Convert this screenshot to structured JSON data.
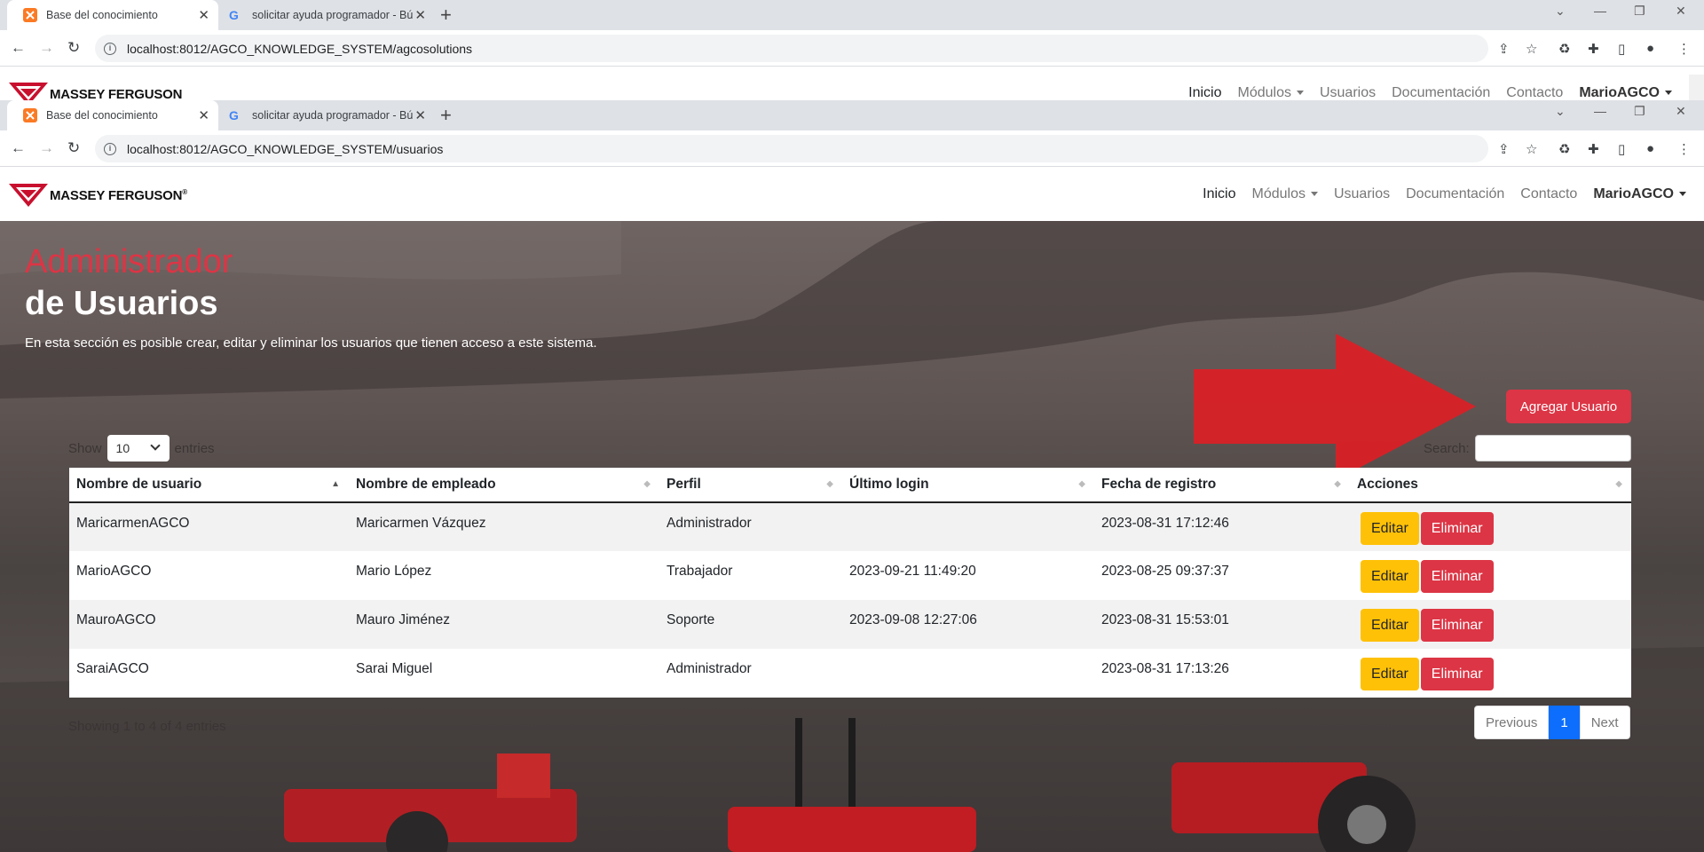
{
  "browser": {
    "tabs": [
      {
        "title": "Base del conocimiento"
      },
      {
        "title": "solicitar ayuda programador - Bú"
      }
    ],
    "url_top": "localhost:8012/AGCO_KNOWLEDGE_SYSTEM/agcosolutions",
    "url": "localhost:8012/AGCO_KNOWLEDGE_SYSTEM/usuarios"
  },
  "nav": {
    "brand": "MASSEY FERGUSON",
    "registered": "®",
    "items": [
      "Inicio",
      "Módulos",
      "Usuarios",
      "Documentación",
      "Contacto"
    ],
    "user": "MarioAGCO"
  },
  "page": {
    "title_line1": "Administrador",
    "title_line2": "de Usuarios",
    "description": "En esta sección es posible crear, editar y eliminar los usuarios que tienen acceso a este sistema.",
    "add_button": "Agregar Usuario"
  },
  "table": {
    "show_label": "Show",
    "entries_label": "entries",
    "page_length": "10",
    "search_label": "Search:",
    "columns": [
      "Nombre de usuario",
      "Nombre de empleado",
      "Perfil",
      "Último login",
      "Fecha de registro",
      "Acciones"
    ],
    "rows": [
      [
        "MaricarmenAGCO",
        "Maricarmen Vázquez",
        "Administrador",
        "",
        "2023-08-31 17:12:46"
      ],
      [
        "MarioAGCO",
        "Mario López",
        "Trabajador",
        "2023-09-21 11:49:20",
        "2023-08-25 09:37:37"
      ],
      [
        "MauroAGCO",
        "Mauro Jiménez",
        "Soporte",
        "2023-09-08 12:27:06",
        "2023-08-31 15:53:01"
      ],
      [
        "SaraiAGCO",
        "Sarai Miguel",
        "Administrador",
        "",
        "2023-08-31 17:13:26"
      ]
    ],
    "edit_label": "Editar",
    "delete_label": "Eliminar",
    "info": "Showing 1 to 4 of 4 entries",
    "previous": "Previous",
    "current_page": "1",
    "next": "Next"
  },
  "colors": {
    "accent": "#dc3545",
    "warning": "#ffc107",
    "primary": "#0d6efd"
  }
}
